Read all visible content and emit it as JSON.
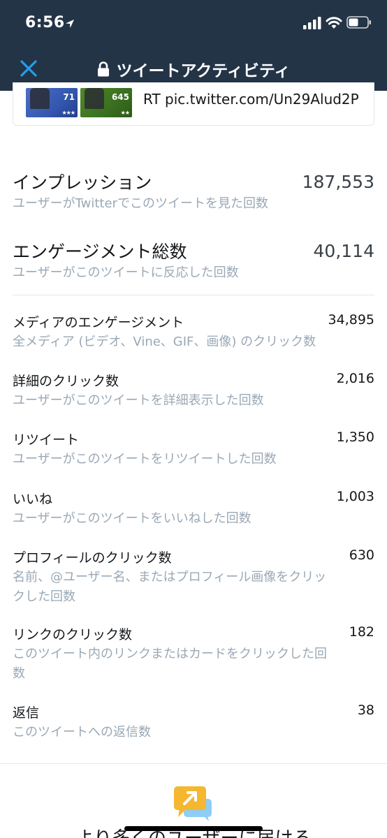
{
  "status_bar": {
    "time": "6:56"
  },
  "nav": {
    "title": "ツイートアクティビティ",
    "close_icon": "close-icon",
    "lock_icon": "lock-icon"
  },
  "tweet_card": {
    "thumbnails": [
      {
        "number": "71",
        "stars": "★★★"
      },
      {
        "number": "645",
        "stars": "★★"
      }
    ],
    "text": "RT pic.twitter.com/Un29Alud2P"
  },
  "primary_metrics": [
    {
      "title": "インプレッション",
      "value": "187,553",
      "description": "ユーザーがTwitterでこのツイートを見た回数"
    },
    {
      "title": "エンゲージメント総数",
      "value": "40,114",
      "description": "ユーザーがこのツイートに反応した回数"
    }
  ],
  "engagement_metrics": [
    {
      "title": "メディアのエンゲージメント",
      "value": "34,895",
      "description": "全メディア (ビデオ、Vine、GIF、画像) のクリック数"
    },
    {
      "title": "詳細のクリック数",
      "value": "2,016",
      "description": "ユーザーがこのツイートを詳細表示した回数"
    },
    {
      "title": "リツイート",
      "value": "1,350",
      "description": "ユーザーがこのツイートをリツイートした回数"
    },
    {
      "title": "いいね",
      "value": "1,003",
      "description": "ユーザーがこのツイートをいいねした回数"
    },
    {
      "title": "プロフィールのクリック数",
      "value": "630",
      "description_lines": [
        "名前、@ユーザー名、またはプロフィール画像をクリッ",
        "クした回数"
      ]
    },
    {
      "title": "リンクのクリック数",
      "value": "182",
      "description_lines": [
        "このツイート内のリンクまたはカードをクリックした回",
        "数"
      ]
    },
    {
      "title": "返信",
      "value": "38",
      "description": "このツイートへの返信数"
    }
  ],
  "promo": {
    "icon": "promote-tweet-icon",
    "text": "より多くのユーザーに届ける"
  },
  "colors": {
    "header_bg": "#243447",
    "accent": "#1da1f2",
    "secondary_text": "#9aa8b5",
    "promo_icon": "#f5b730"
  }
}
